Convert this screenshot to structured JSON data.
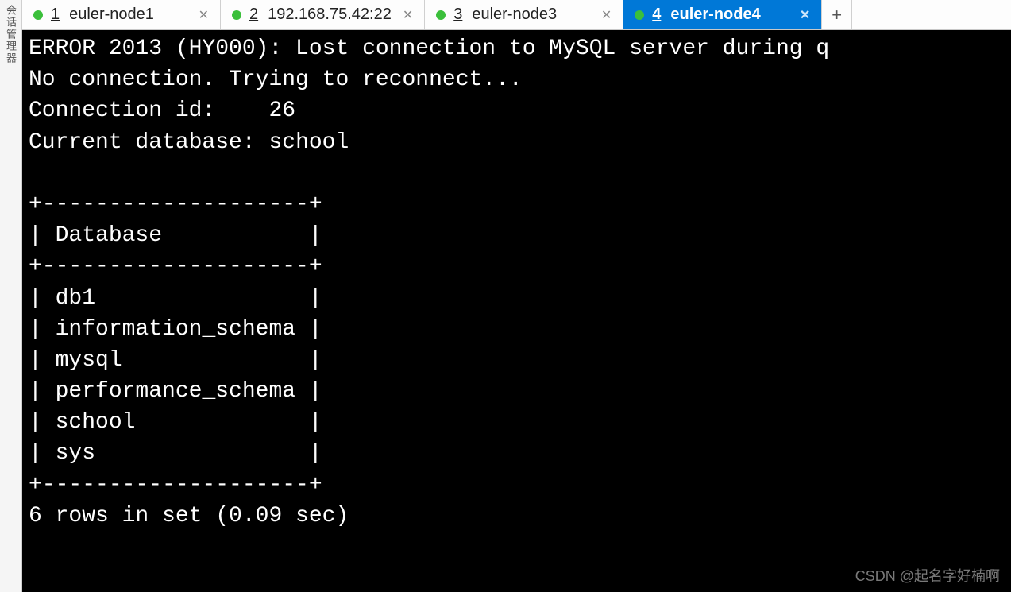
{
  "sidebar": {
    "label": "会话管理器"
  },
  "tabs": [
    {
      "num": "1",
      "title": "euler-node1",
      "active": false
    },
    {
      "num": "2",
      "title": "192.168.75.42:22",
      "active": false
    },
    {
      "num": "3",
      "title": "euler-node3",
      "active": false
    },
    {
      "num": "4",
      "title": "euler-node4",
      "active": true
    }
  ],
  "newtab_label": "+",
  "terminal": {
    "error_line": "ERROR 2013 (HY000): Lost connection to MySQL server during q",
    "reconnect_line": "No connection. Trying to reconnect...",
    "conn_id_label": "Connection id:",
    "conn_id_value": "26",
    "current_db_label": "Current database:",
    "current_db_value": "school",
    "table_header": "Database",
    "rows": [
      "db1",
      "information_schema",
      "mysql",
      "performance_schema",
      "school",
      "sys"
    ],
    "footer": "6 rows in set (0.09 sec)"
  },
  "watermark": "CSDN @起名字好楠啊"
}
